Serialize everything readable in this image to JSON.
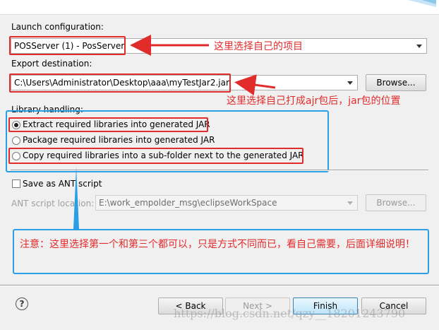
{
  "launch": {
    "label": "Launch configuration:",
    "value": "POSServer (1) - PosServer",
    "note": "这里选择自己的项目"
  },
  "export": {
    "label": "Export destination:",
    "value": "C:\\Users\\Administrator\\Desktop\\aaa\\myTestJar2.jar",
    "browse": "Browse...",
    "note": "这里选择自己打成ajr包后，jar包的位置"
  },
  "library": {
    "label": "Library handling:",
    "options": [
      {
        "label": "Extract required libraries into generated JAR",
        "selected": true
      },
      {
        "label": "Package required libraries into generated JAR",
        "selected": false
      },
      {
        "label": "Copy required libraries into a sub-folder next to the generated JAR",
        "selected": false
      }
    ]
  },
  "ant": {
    "save_label": "Save as ANT script",
    "location_label": "ANT script location:",
    "location_value": "E:\\work_empolder_msg\\eclipseWorkSpace",
    "browse": "Browse..."
  },
  "note_box": {
    "text": "注意：这里选择第一个和第三个都可以，只是方式不同而已，看自己需要，后面详细说明！"
  },
  "footer": {
    "help": "?",
    "back": "< Back",
    "next": "Next >",
    "finish": "Finish",
    "cancel": "Cancel"
  },
  "watermark": "https://blog.csdn.net/qzy__18201243790",
  "colors": {
    "annotation_red": "#e22b2b",
    "annotation_blue": "#2b9fe6"
  }
}
